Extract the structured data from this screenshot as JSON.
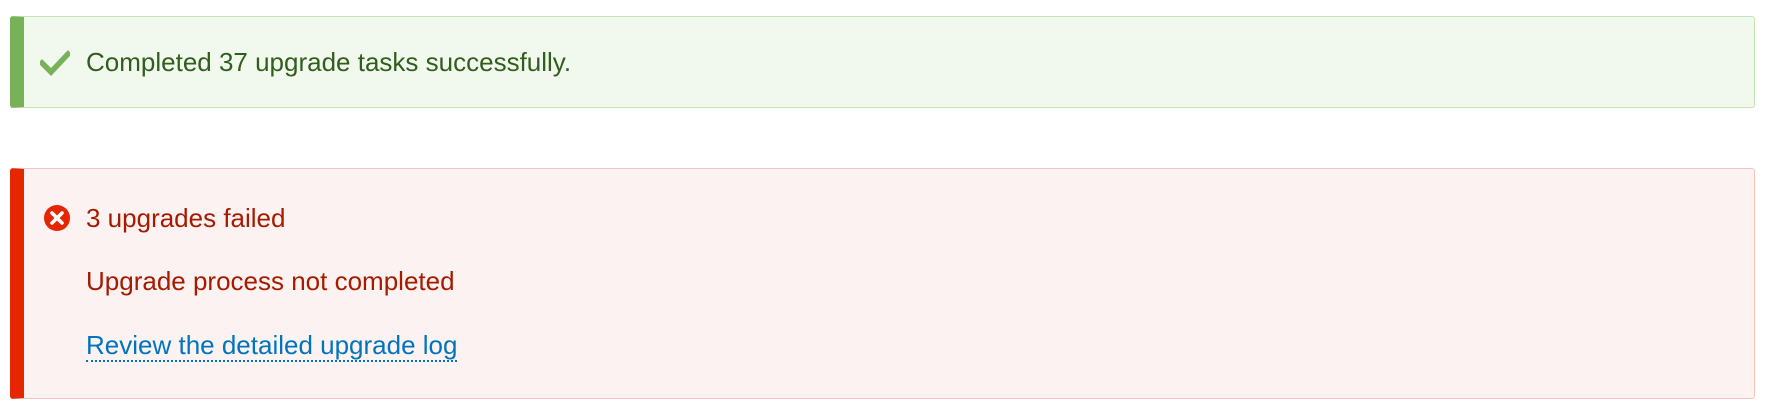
{
  "success_message": {
    "icon": "checkmark-icon",
    "text": "Completed 37 upgrade tasks successfully.",
    "color": "#325e1c",
    "accent": "#77b259"
  },
  "error_message": {
    "icon": "error-x-icon",
    "title": "3 upgrades failed",
    "detail": "Upgrade process not completed",
    "link_label": "Review the detailed upgrade log",
    "color": "#a51b00",
    "accent": "#e62600",
    "link_color": "#0074bd"
  }
}
